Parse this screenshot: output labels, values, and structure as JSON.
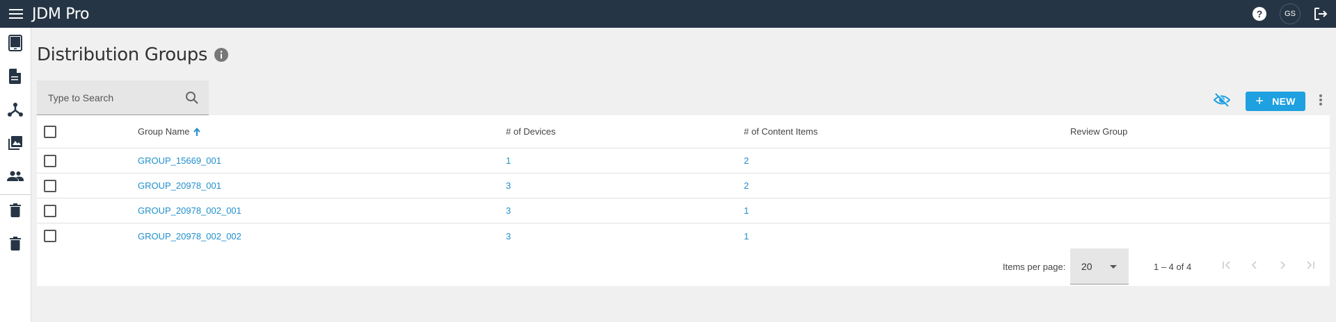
{
  "app": {
    "title": "JDM Pro"
  },
  "topbar": {
    "icons": [
      "menu-icon",
      "help-icon",
      "logout-icon"
    ],
    "avatar_initials": "GS"
  },
  "sidebar": {
    "items": [
      {
        "icon": "tablet-icon"
      },
      {
        "icon": "document-icon"
      },
      {
        "icon": "hierarchy-icon"
      },
      {
        "icon": "media-library-icon"
      },
      {
        "icon": "people-icon"
      },
      {
        "icon": "trash-icon"
      },
      {
        "icon": "trash-icon"
      }
    ]
  },
  "page": {
    "title": "Distribution Groups"
  },
  "search": {
    "placeholder": "Type to Search",
    "value": ""
  },
  "toolbar": {
    "new_label": "NEW"
  },
  "table": {
    "columns": [
      "Group Name",
      "# of Devices",
      "# of Content Items",
      "Review Group"
    ],
    "sort": {
      "column": "Group Name",
      "direction": "ascending"
    },
    "rows": [
      {
        "name": "GROUP_15669_001",
        "devices": "1",
        "content_items": "2",
        "review_group": ""
      },
      {
        "name": "GROUP_20978_001",
        "devices": "3",
        "content_items": "2",
        "review_group": ""
      },
      {
        "name": "GROUP_20978_002_001",
        "devices": "3",
        "content_items": "1",
        "review_group": ""
      },
      {
        "name": "GROUP_20978_002_002",
        "devices": "3",
        "content_items": "1",
        "review_group": ""
      }
    ]
  },
  "paginator": {
    "items_per_page_label": "Items per page:",
    "items_per_page": "20",
    "range": "1 – 4 of 4"
  },
  "colors": {
    "topbar": "#263545",
    "accent": "#1fa0e0",
    "link": "#1f8fcc",
    "background": "#f0f0f0"
  }
}
